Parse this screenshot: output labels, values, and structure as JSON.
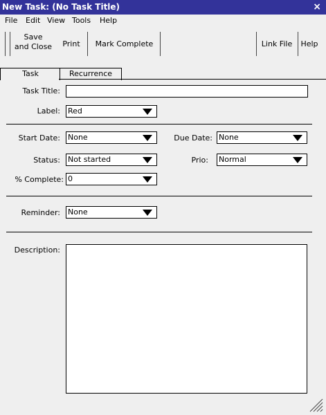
{
  "window": {
    "title": "New Task: (No Task Title)",
    "close": "×"
  },
  "menu": [
    "File",
    "Edit",
    "View",
    "Tools",
    "Help"
  ],
  "toolbar": {
    "save_close": [
      "Save",
      "and Close"
    ],
    "print": "Print",
    "mark_complete": "Mark Complete",
    "link_file": "Link File",
    "help": "Help"
  },
  "tabs": [
    "Task",
    "Recurrence"
  ],
  "form": {
    "task_title": {
      "label": "Task Title:",
      "value": ""
    },
    "label": {
      "label": "Label:",
      "value": "Red"
    },
    "start_date": {
      "label": "Start Date:",
      "value": "None"
    },
    "due_date": {
      "label": "Due Date:",
      "value": "None"
    },
    "status": {
      "label": "Status:",
      "value": "Not started"
    },
    "prio": {
      "label": "Prio:",
      "value": "Normal"
    },
    "percent_complete": {
      "label": "% Complete:",
      "value": "0"
    },
    "reminder": {
      "label": "Reminder:",
      "value": "None"
    },
    "description": {
      "label": "Description:",
      "value": ""
    }
  }
}
